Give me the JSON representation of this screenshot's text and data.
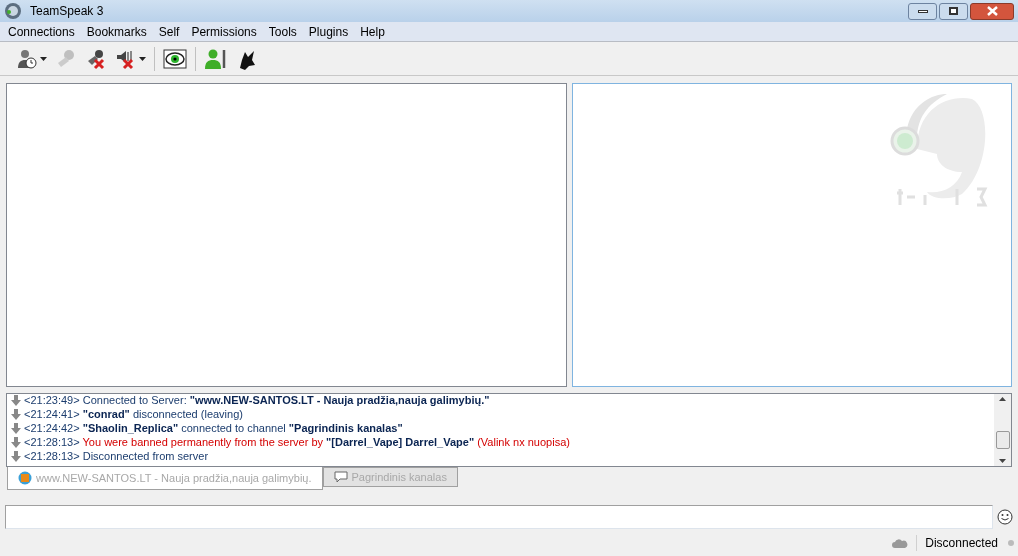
{
  "window": {
    "title": "TeamSpeak 3"
  },
  "menu": [
    "Connections",
    "Bookmarks",
    "Self",
    "Permissions",
    "Tools",
    "Plugins",
    "Help"
  ],
  "toolbar": [
    {
      "kind": "connect",
      "dropdown": true,
      "disabled": false
    },
    {
      "kind": "away",
      "dropdown": false,
      "disabled": true
    },
    {
      "kind": "mic_mute",
      "dropdown": false,
      "disabled": false
    },
    {
      "kind": "speaker_mute",
      "dropdown": true,
      "disabled": false
    },
    {
      "kind": "separator"
    },
    {
      "kind": "view",
      "dropdown": false,
      "disabled": false
    },
    {
      "kind": "separator"
    },
    {
      "kind": "identity",
      "dropdown": false,
      "disabled": false
    },
    {
      "kind": "wolf",
      "dropdown": false,
      "disabled": false
    }
  ],
  "log": [
    {
      "time": "<21:23:49>",
      "parts": [
        {
          "kind": "plain",
          "text": "Connected to Server: "
        },
        {
          "kind": "name",
          "text": "\"www.NEW-SANTOS.LT - Nauja pradžia,nauja galimybių.\""
        }
      ]
    },
    {
      "time": "<21:24:41>",
      "parts": [
        {
          "kind": "name",
          "text": "\"conrad\""
        },
        {
          "kind": "plain",
          "text": " disconnected (leaving)"
        }
      ]
    },
    {
      "time": "<21:24:42>",
      "parts": [
        {
          "kind": "name",
          "text": "\"Shaolin_Replica\""
        },
        {
          "kind": "plain",
          "text": " connected to channel "
        },
        {
          "kind": "name",
          "text": "\"Pagrindinis kanalas\""
        }
      ]
    },
    {
      "time": "<21:28:13>",
      "parts": [
        {
          "kind": "error",
          "text": "You were banned permanently from the server by "
        },
        {
          "kind": "name",
          "text": "\"[Darrel_Vape] Darrel_Vape\""
        },
        {
          "kind": "error",
          "text": " (Valink nx nuopisa)"
        }
      ]
    },
    {
      "time": "<21:28:13>",
      "parts": [
        {
          "kind": "plain",
          "text": "Disconnected from server"
        }
      ]
    }
  ],
  "chat_tabs": [
    {
      "kind": "server",
      "label": "www.NEW-SANTOS.LT - Nauja pradžia,nauja galimybių.",
      "selected": true
    },
    {
      "kind": "channel",
      "label": "Pagrindinis kanalas",
      "selected": false
    }
  ],
  "status_bar": {
    "status": "Disconnected"
  }
}
